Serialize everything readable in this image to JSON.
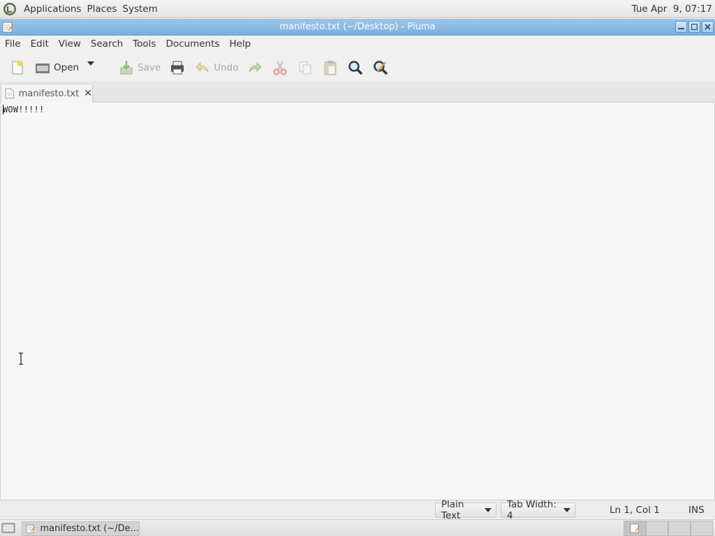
{
  "top_panel": {
    "menus": [
      "Applications",
      "Places",
      "System"
    ],
    "clock": "Tue Apr  9, 07:17"
  },
  "window": {
    "title": "manifesto.txt (~/Desktop) - Pluma"
  },
  "menubar": {
    "items": [
      "File",
      "Edit",
      "View",
      "Search",
      "Tools",
      "Documents",
      "Help"
    ]
  },
  "toolbar": {
    "open_label": "Open",
    "save_label": "Save",
    "undo_label": "Undo"
  },
  "tabs": [
    {
      "label": "manifesto.txt"
    }
  ],
  "editor": {
    "content": "WOW!!!!!"
  },
  "statusbar": {
    "language": "Plain Text",
    "tab_width": "Tab Width: 4",
    "position": "Ln 1, Col 1",
    "mode": "INS"
  },
  "taskbar": {
    "task_label": "manifesto.txt (~/De..."
  },
  "colors": {
    "titlebar": "#7aafe0",
    "editor_bg": "#f7f7f7"
  }
}
